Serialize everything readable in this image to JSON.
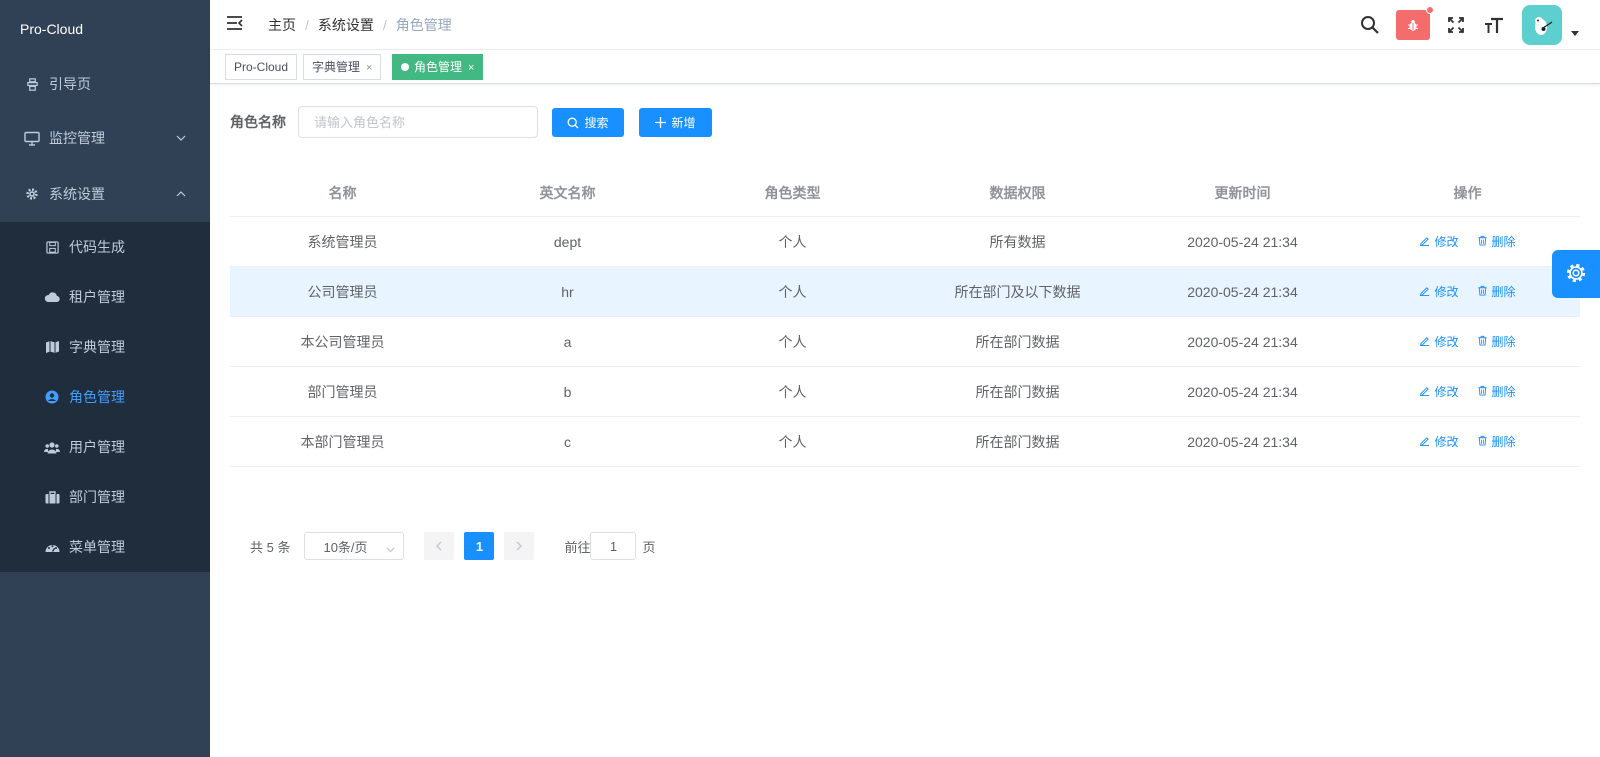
{
  "app": {
    "logo": "Pro-Cloud"
  },
  "sidebar": {
    "items": [
      {
        "label": "引导页",
        "icon": "guide-icon"
      },
      {
        "label": "监控管理",
        "icon": "monitor-icon",
        "expanded": false
      },
      {
        "label": "系统设置",
        "icon": "gear-icon",
        "expanded": true
      }
    ],
    "submenu": [
      {
        "label": "代码生成",
        "icon": "save-icon"
      },
      {
        "label": "租户管理",
        "icon": "cloud-icon"
      },
      {
        "label": "字典管理",
        "icon": "map-icon"
      },
      {
        "label": "角色管理",
        "icon": "user-circle-icon",
        "active": true
      },
      {
        "label": "用户管理",
        "icon": "users-icon"
      },
      {
        "label": "部门管理",
        "icon": "briefcase-icon"
      },
      {
        "label": "菜单管理",
        "icon": "dashboard-icon"
      }
    ]
  },
  "breadcrumb": [
    "主页",
    "系统设置",
    "角色管理"
  ],
  "tags": [
    {
      "label": "Pro-Cloud",
      "closable": false
    },
    {
      "label": "字典管理",
      "closable": true,
      "close": "×"
    },
    {
      "label": "角色管理",
      "closable": true,
      "active": true,
      "close": "×"
    }
  ],
  "search": {
    "label": "角色名称",
    "placeholder": "请输入角色名称",
    "value": "",
    "search_label": "搜索",
    "add_label": "新增"
  },
  "table": {
    "headers": [
      "名称",
      "英文名称",
      "角色类型",
      "数据权限",
      "更新时间",
      "操作"
    ],
    "rows": [
      [
        "系统管理员",
        "dept",
        "个人",
        "所有数据",
        "2020-05-24 21:34"
      ],
      [
        "公司管理员",
        "hr",
        "个人",
        "所在部门及以下数据",
        "2020-05-24 21:34"
      ],
      [
        "本公司管理员",
        "a",
        "个人",
        "所在部门数据",
        "2020-05-24 21:34"
      ],
      [
        "部门管理员",
        "b",
        "个人",
        "所在部门数据",
        "2020-05-24 21:34"
      ],
      [
        "本部门管理员",
        "c",
        "个人",
        "所在部门数据",
        "2020-05-24 21:34"
      ]
    ],
    "edit_label": "修改",
    "delete_label": "删除"
  },
  "pagination": {
    "total": "共 5 条",
    "page_size": "10条/页",
    "current": "1",
    "goto_prefix": "前往",
    "goto_value": "1",
    "goto_suffix": "页"
  },
  "colors": {
    "sidebar_bg": "#304156",
    "submenu_bg": "#1f2d3d",
    "primary": "#1890ff",
    "tag_active": "#42b983",
    "bug": "#f56c6c"
  }
}
